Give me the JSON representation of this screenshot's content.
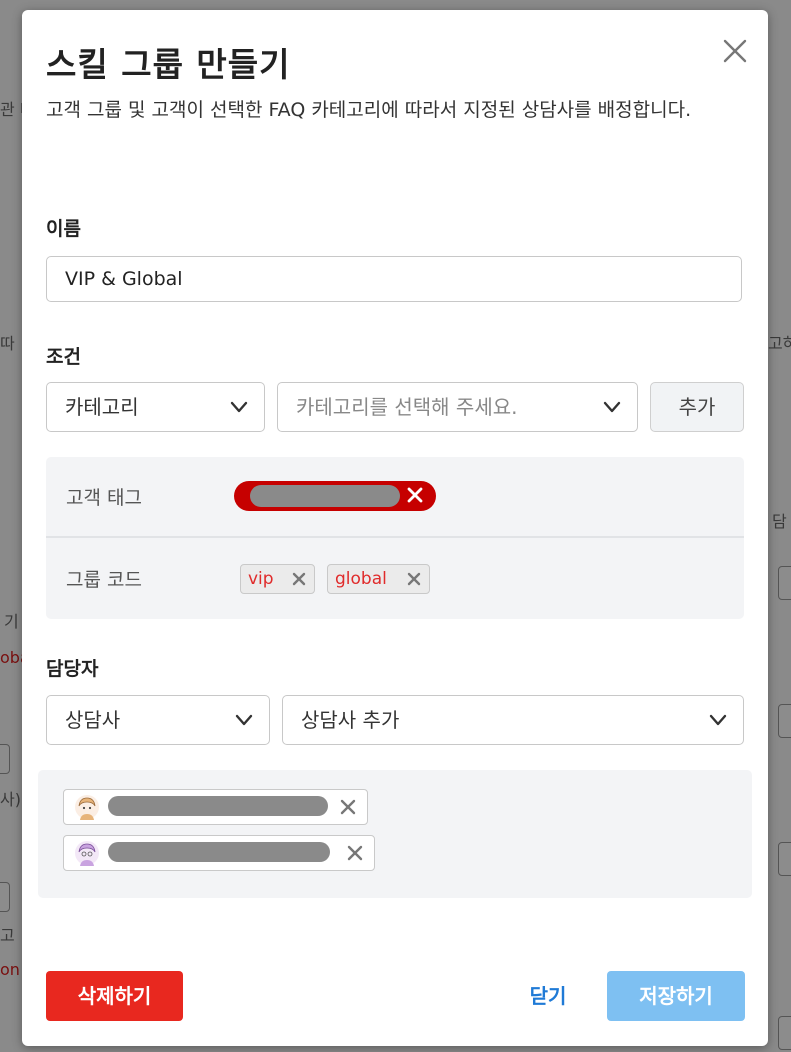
{
  "background": {
    "left_fragments": [
      "관 비",
      "따",
      "기",
      "oba",
      "사)",
      "고",
      "on"
    ],
    "right_fragments": [
      "고하",
      "담"
    ]
  },
  "modal": {
    "title": "스킬 그룹 만들기",
    "description": "고객 그룹 및 고객이 선택한 FAQ 카테고리에 따라서 지정된 상담사를 배정합니다.",
    "close_icon": "close-icon",
    "name_section": {
      "label": "이름",
      "value": "VIP & Global"
    },
    "condition_section": {
      "label": "조건",
      "type_select_value": "카테고리",
      "category_select_placeholder": "카테고리를 선택해 주세요.",
      "add_button_label": "추가",
      "rows": [
        {
          "label": "고객 태그",
          "tags": [
            "(redacted)"
          ]
        },
        {
          "label": "그룹 코드",
          "tags": [
            "vip",
            "global"
          ]
        }
      ]
    },
    "assignee_section": {
      "label": "담당자",
      "type_select_value": "상담사",
      "agent_select_placeholder": "상담사 추가",
      "agents": [
        {
          "name": "(redacted)",
          "avatar": "avatar-icon"
        },
        {
          "name": "(redacted)",
          "avatar": "avatar-icon"
        }
      ]
    },
    "footer": {
      "delete_label": "삭제하기",
      "close_label": "닫기",
      "save_label": "저장하기"
    }
  },
  "colors": {
    "delete": "#e8281f",
    "save_disabled": "#7ec0f2",
    "link": "#1f7ad6",
    "customer_tag": "#c60000",
    "group_code_text": "#e02b2b"
  }
}
